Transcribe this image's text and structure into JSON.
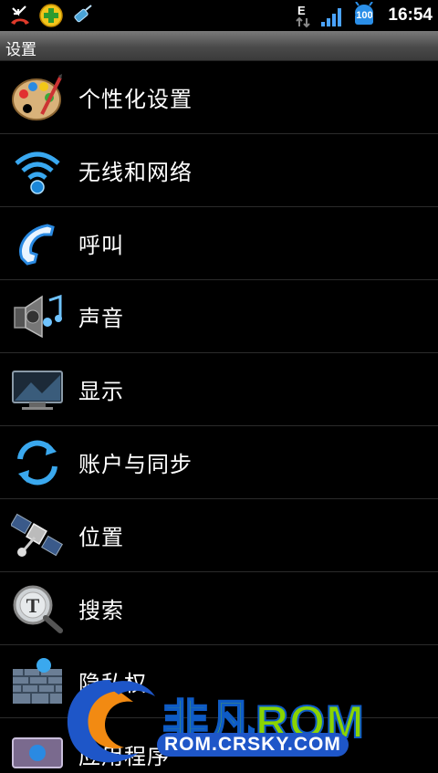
{
  "statusbar": {
    "left_icons": [
      "missed-call-icon",
      "app-plus-icon",
      "usb-debug-icon"
    ],
    "network_type": "E",
    "battery_level": "100",
    "time": "16:54"
  },
  "titlebar": {
    "title": "设置"
  },
  "settings": [
    {
      "label": "个性化设置",
      "icon": "palette-icon"
    },
    {
      "label": "无线和网络",
      "icon": "wifi-icon"
    },
    {
      "label": "呼叫",
      "icon": "phone-handset-icon"
    },
    {
      "label": "声音",
      "icon": "speaker-icon"
    },
    {
      "label": "显示",
      "icon": "monitor-icon"
    },
    {
      "label": "账户与同步",
      "icon": "sync-icon"
    },
    {
      "label": "位置",
      "icon": "satellite-icon"
    },
    {
      "label": "搜索",
      "icon": "search-icon"
    },
    {
      "label": "隐私权",
      "icon": "privacy-wall-icon"
    },
    {
      "label": "应用程序",
      "icon": "apps-icon"
    }
  ],
  "watermark": {
    "brand": "非凡ROM",
    "url": "ROM.CRSKY.COM"
  },
  "colors": {
    "background": "#000000",
    "divider": "#2b2b2b",
    "titlebar": "#5a5a5a",
    "watermark_green": "#8ad400",
    "watermark_blue": "#1e56c8"
  }
}
